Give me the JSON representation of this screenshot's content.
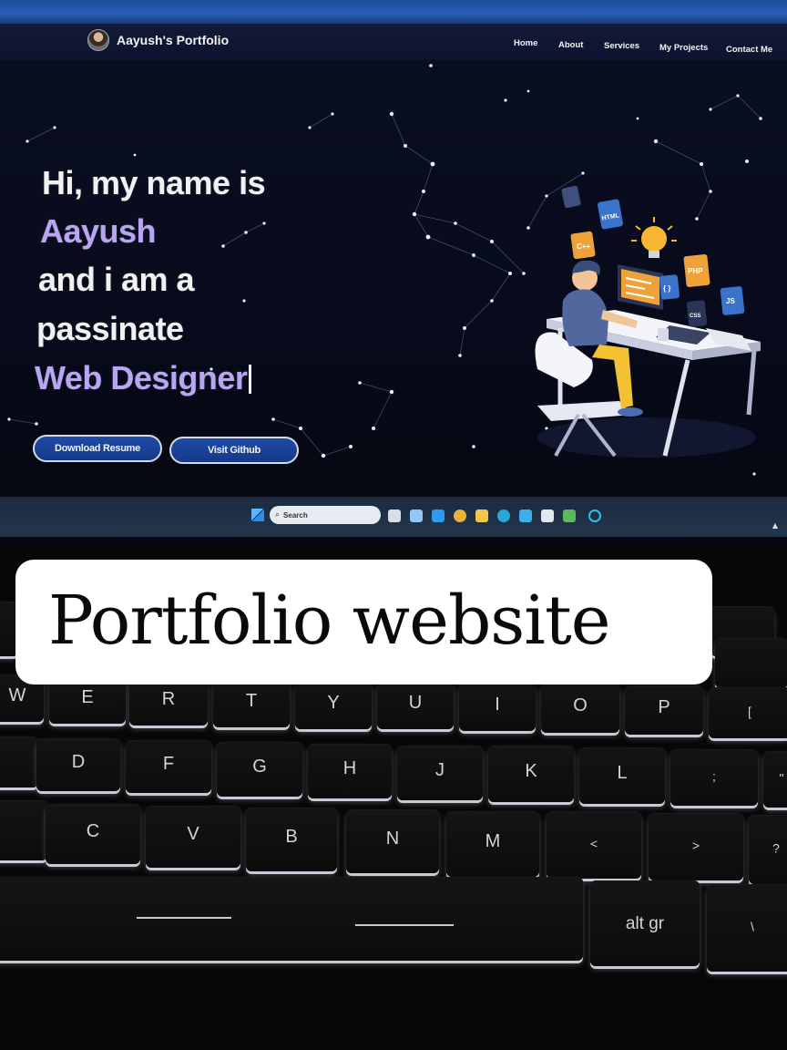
{
  "browser": {
    "tab_text": ""
  },
  "site": {
    "brand": "Aayush's Portfolio",
    "nav": [
      "Home",
      "About",
      "Services",
      "My Projects",
      "Contact Me"
    ],
    "hero": {
      "line1": "Hi, my name is",
      "line2": "Aayush",
      "line3": "and i am a",
      "line4": "passinate",
      "line5": "Web Designer"
    },
    "buttons": {
      "resume": "Download Resume",
      "github": "Visit Github"
    },
    "illustration_tags": [
      "HTML",
      "C++",
      "PHP",
      "JS",
      "CSS",
      "{ }"
    ]
  },
  "taskbar": {
    "search_placeholder": "Search"
  },
  "caption": "Portfolio website",
  "keyboard": {
    "row_top": [
      "W",
      "E",
      "R",
      "T",
      "Y",
      "U",
      "I",
      "O",
      "P"
    ],
    "row_mid": [
      "D",
      "F",
      "G",
      "H",
      "J",
      "K",
      "L",
      ";",
      "\""
    ],
    "row_bottom": [
      "C",
      "V",
      "B",
      "N",
      "M",
      "<",
      ">",
      "?"
    ],
    "special": {
      "altgr": "alt gr",
      "comma": ",",
      "period": ".",
      "bracket": "[",
      "pipe": "\\"
    }
  },
  "colors": {
    "accent_purple": "#b9a6f2",
    "button_blue": "#1f4aa6",
    "screen_bg": "#0a0f22",
    "caption_bg": "#ffffff"
  }
}
